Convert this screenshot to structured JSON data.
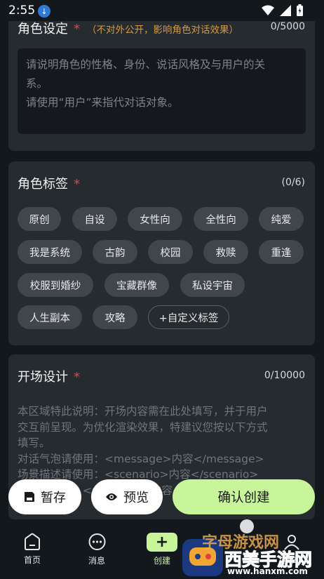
{
  "status": {
    "time": "2:55"
  },
  "role_setting": {
    "title": "角色设定",
    "required_mark": "*",
    "hint": "（不对外公开，影响角色对话效果）",
    "counter": "0/5000",
    "placeholder_line1": "请说明角色的性格、身份、说话风格及与用户的关",
    "placeholder_line2": "系。",
    "placeholder_line3": "请使用“用户”来指代对话对象。"
  },
  "role_tags": {
    "title": "角色标签",
    "required_mark": "*",
    "counter": "(0/6)",
    "tags": [
      "原创",
      "自设",
      "女性向",
      "全性向",
      "纯爱",
      "我是系统",
      "古韵",
      "校园",
      "救赎",
      "重逢",
      "校服到婚纱",
      "宝藏群像",
      "私设宇宙",
      "人生副本",
      "攻略"
    ],
    "custom_tag": "+自定义标签"
  },
  "opening": {
    "title": "开场设计",
    "required_mark": "*",
    "counter": "0/10000",
    "lines": [
      "本区域特此说明：开场内容需在此处填写，并于用户",
      "交互前呈现。为优化渲染效果，特建议您按以下方式",
      "填写。",
      "对话气泡请使用：<message>内容</message>",
      "场景描述请使用：<scenario>内容</scenario>",
      "旁白请使用：<narration>内容</narration>"
    ]
  },
  "actions": {
    "save": "暂存",
    "preview": "预览",
    "confirm": "确认创建"
  },
  "nav": {
    "home": "首页",
    "messages": "消息",
    "create": "创建",
    "me": "我的"
  },
  "watermark": {
    "line1": "字母游戏网",
    "line2": "西美手游网",
    "url": "www.hanxm.com"
  }
}
